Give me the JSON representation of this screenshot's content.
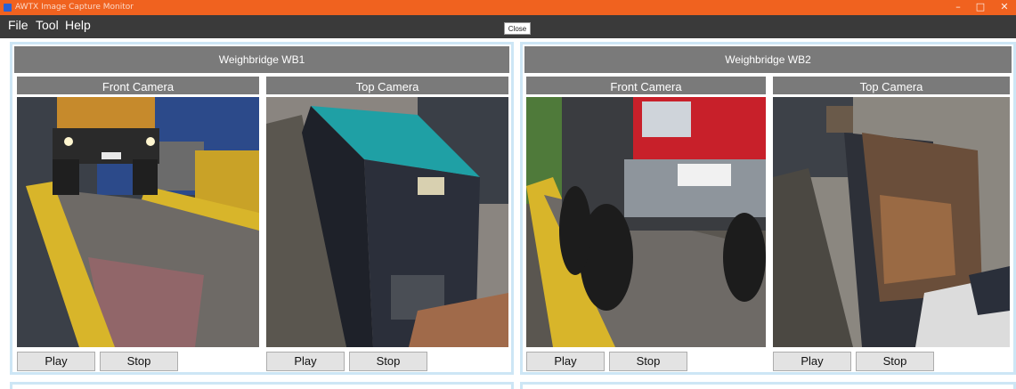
{
  "window": {
    "title": "AWTX Image Capture Monitor",
    "minimize": "–",
    "maximize": "□",
    "close": "✕"
  },
  "menu": {
    "items": [
      "File",
      "Tool",
      "Help"
    ],
    "close_label": "Close"
  },
  "panels": [
    {
      "title": "Weighbridge WB1",
      "cameras": [
        {
          "label": "Front Camera",
          "play": "Play",
          "stop": "Stop"
        },
        {
          "label": "Top Camera",
          "play": "Play",
          "stop": "Stop"
        }
      ]
    },
    {
      "title": "Weighbridge WB2",
      "cameras": [
        {
          "label": "Front Camera",
          "play": "Play",
          "stop": "Stop"
        },
        {
          "label": "Top Camera",
          "play": "Play",
          "stop": "Stop"
        }
      ]
    }
  ],
  "colors": {
    "titlebar": "#f0621f",
    "menubar": "#3a3a3a",
    "header": "#7a7a7a",
    "panel_border": "#cde6f5",
    "button": "#e3e3e3"
  }
}
